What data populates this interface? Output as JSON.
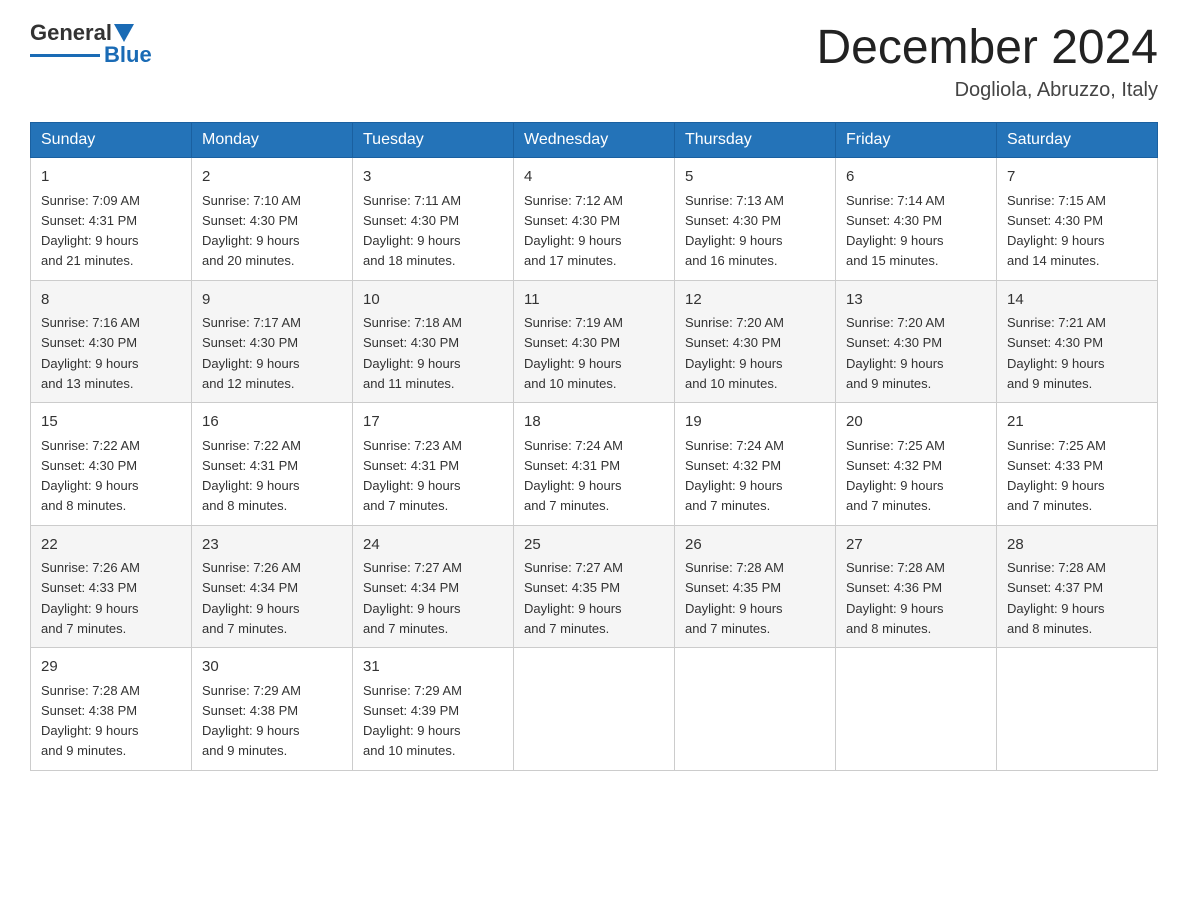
{
  "logo": {
    "general": "General",
    "blue": "Blue"
  },
  "header": {
    "month": "December 2024",
    "location": "Dogliola, Abruzzo, Italy"
  },
  "days_header": [
    "Sunday",
    "Monday",
    "Tuesday",
    "Wednesday",
    "Thursday",
    "Friday",
    "Saturday"
  ],
  "weeks": [
    [
      {
        "day": "1",
        "sunrise": "7:09 AM",
        "sunset": "4:31 PM",
        "daylight": "9 hours and 21 minutes."
      },
      {
        "day": "2",
        "sunrise": "7:10 AM",
        "sunset": "4:30 PM",
        "daylight": "9 hours and 20 minutes."
      },
      {
        "day": "3",
        "sunrise": "7:11 AM",
        "sunset": "4:30 PM",
        "daylight": "9 hours and 18 minutes."
      },
      {
        "day": "4",
        "sunrise": "7:12 AM",
        "sunset": "4:30 PM",
        "daylight": "9 hours and 17 minutes."
      },
      {
        "day": "5",
        "sunrise": "7:13 AM",
        "sunset": "4:30 PM",
        "daylight": "9 hours and 16 minutes."
      },
      {
        "day": "6",
        "sunrise": "7:14 AM",
        "sunset": "4:30 PM",
        "daylight": "9 hours and 15 minutes."
      },
      {
        "day": "7",
        "sunrise": "7:15 AM",
        "sunset": "4:30 PM",
        "daylight": "9 hours and 14 minutes."
      }
    ],
    [
      {
        "day": "8",
        "sunrise": "7:16 AM",
        "sunset": "4:30 PM",
        "daylight": "9 hours and 13 minutes."
      },
      {
        "day": "9",
        "sunrise": "7:17 AM",
        "sunset": "4:30 PM",
        "daylight": "9 hours and 12 minutes."
      },
      {
        "day": "10",
        "sunrise": "7:18 AM",
        "sunset": "4:30 PM",
        "daylight": "9 hours and 11 minutes."
      },
      {
        "day": "11",
        "sunrise": "7:19 AM",
        "sunset": "4:30 PM",
        "daylight": "9 hours and 10 minutes."
      },
      {
        "day": "12",
        "sunrise": "7:20 AM",
        "sunset": "4:30 PM",
        "daylight": "9 hours and 10 minutes."
      },
      {
        "day": "13",
        "sunrise": "7:20 AM",
        "sunset": "4:30 PM",
        "daylight": "9 hours and 9 minutes."
      },
      {
        "day": "14",
        "sunrise": "7:21 AM",
        "sunset": "4:30 PM",
        "daylight": "9 hours and 9 minutes."
      }
    ],
    [
      {
        "day": "15",
        "sunrise": "7:22 AM",
        "sunset": "4:30 PM",
        "daylight": "9 hours and 8 minutes."
      },
      {
        "day": "16",
        "sunrise": "7:22 AM",
        "sunset": "4:31 PM",
        "daylight": "9 hours and 8 minutes."
      },
      {
        "day": "17",
        "sunrise": "7:23 AM",
        "sunset": "4:31 PM",
        "daylight": "9 hours and 7 minutes."
      },
      {
        "day": "18",
        "sunrise": "7:24 AM",
        "sunset": "4:31 PM",
        "daylight": "9 hours and 7 minutes."
      },
      {
        "day": "19",
        "sunrise": "7:24 AM",
        "sunset": "4:32 PM",
        "daylight": "9 hours and 7 minutes."
      },
      {
        "day": "20",
        "sunrise": "7:25 AM",
        "sunset": "4:32 PM",
        "daylight": "9 hours and 7 minutes."
      },
      {
        "day": "21",
        "sunrise": "7:25 AM",
        "sunset": "4:33 PM",
        "daylight": "9 hours and 7 minutes."
      }
    ],
    [
      {
        "day": "22",
        "sunrise": "7:26 AM",
        "sunset": "4:33 PM",
        "daylight": "9 hours and 7 minutes."
      },
      {
        "day": "23",
        "sunrise": "7:26 AM",
        "sunset": "4:34 PM",
        "daylight": "9 hours and 7 minutes."
      },
      {
        "day": "24",
        "sunrise": "7:27 AM",
        "sunset": "4:34 PM",
        "daylight": "9 hours and 7 minutes."
      },
      {
        "day": "25",
        "sunrise": "7:27 AM",
        "sunset": "4:35 PM",
        "daylight": "9 hours and 7 minutes."
      },
      {
        "day": "26",
        "sunrise": "7:28 AM",
        "sunset": "4:35 PM",
        "daylight": "9 hours and 7 minutes."
      },
      {
        "day": "27",
        "sunrise": "7:28 AM",
        "sunset": "4:36 PM",
        "daylight": "9 hours and 8 minutes."
      },
      {
        "day": "28",
        "sunrise": "7:28 AM",
        "sunset": "4:37 PM",
        "daylight": "9 hours and 8 minutes."
      }
    ],
    [
      {
        "day": "29",
        "sunrise": "7:28 AM",
        "sunset": "4:38 PM",
        "daylight": "9 hours and 9 minutes."
      },
      {
        "day": "30",
        "sunrise": "7:29 AM",
        "sunset": "4:38 PM",
        "daylight": "9 hours and 9 minutes."
      },
      {
        "day": "31",
        "sunrise": "7:29 AM",
        "sunset": "4:39 PM",
        "daylight": "9 hours and 10 minutes."
      },
      null,
      null,
      null,
      null
    ]
  ],
  "labels": {
    "sunrise": "Sunrise:",
    "sunset": "Sunset:",
    "daylight": "Daylight:"
  }
}
